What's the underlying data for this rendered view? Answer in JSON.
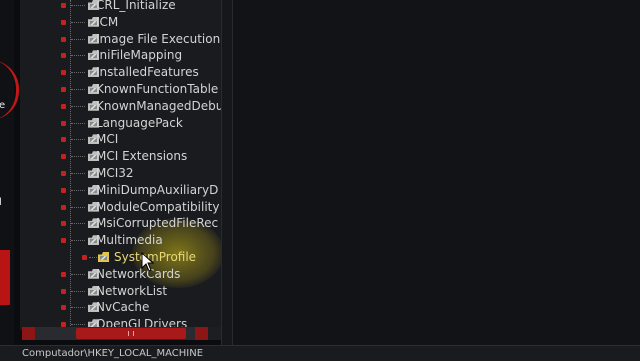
{
  "left_strip": {
    "text_a": "e",
    "text_b": "l"
  },
  "tree": {
    "items": [
      {
        "label": "CRL_Initialize",
        "type": "folder"
      },
      {
        "label": "ICM",
        "type": "folder"
      },
      {
        "label": "Image File Execution",
        "type": "folder"
      },
      {
        "label": "IniFileMapping",
        "type": "folder"
      },
      {
        "label": "InstalledFeatures",
        "type": "folder"
      },
      {
        "label": "KnownFunctionTable",
        "type": "folder"
      },
      {
        "label": "KnownManagedDebu",
        "type": "folder"
      },
      {
        "label": "LanguagePack",
        "type": "folder"
      },
      {
        "label": "MCI",
        "type": "folder"
      },
      {
        "label": "MCI Extensions",
        "type": "folder"
      },
      {
        "label": "MCI32",
        "type": "folder"
      },
      {
        "label": "MiniDumpAuxiliaryD",
        "type": "folder"
      },
      {
        "label": "ModuleCompatibility",
        "type": "folder"
      },
      {
        "label": "MsiCorruptedFileRec",
        "type": "folder"
      },
      {
        "label": "Multimedia",
        "type": "folder"
      },
      {
        "label": "SystemProfile",
        "type": "child-folder"
      },
      {
        "label": "NetworkCards",
        "type": "folder"
      },
      {
        "label": "NetworkList",
        "type": "folder"
      },
      {
        "label": "NvCache",
        "type": "folder"
      },
      {
        "label": "OpenGLDrivers",
        "type": "folder"
      }
    ]
  },
  "status": {
    "path": "Computador\\HKEY_LOCAL_MACHINE"
  },
  "icons": {
    "folder": "folder-icon",
    "expander": "expander-icon",
    "cursor": "mouse-cursor-icon"
  },
  "colors": {
    "accent_red": "#a81a1a",
    "highlight": "#d2be14"
  }
}
